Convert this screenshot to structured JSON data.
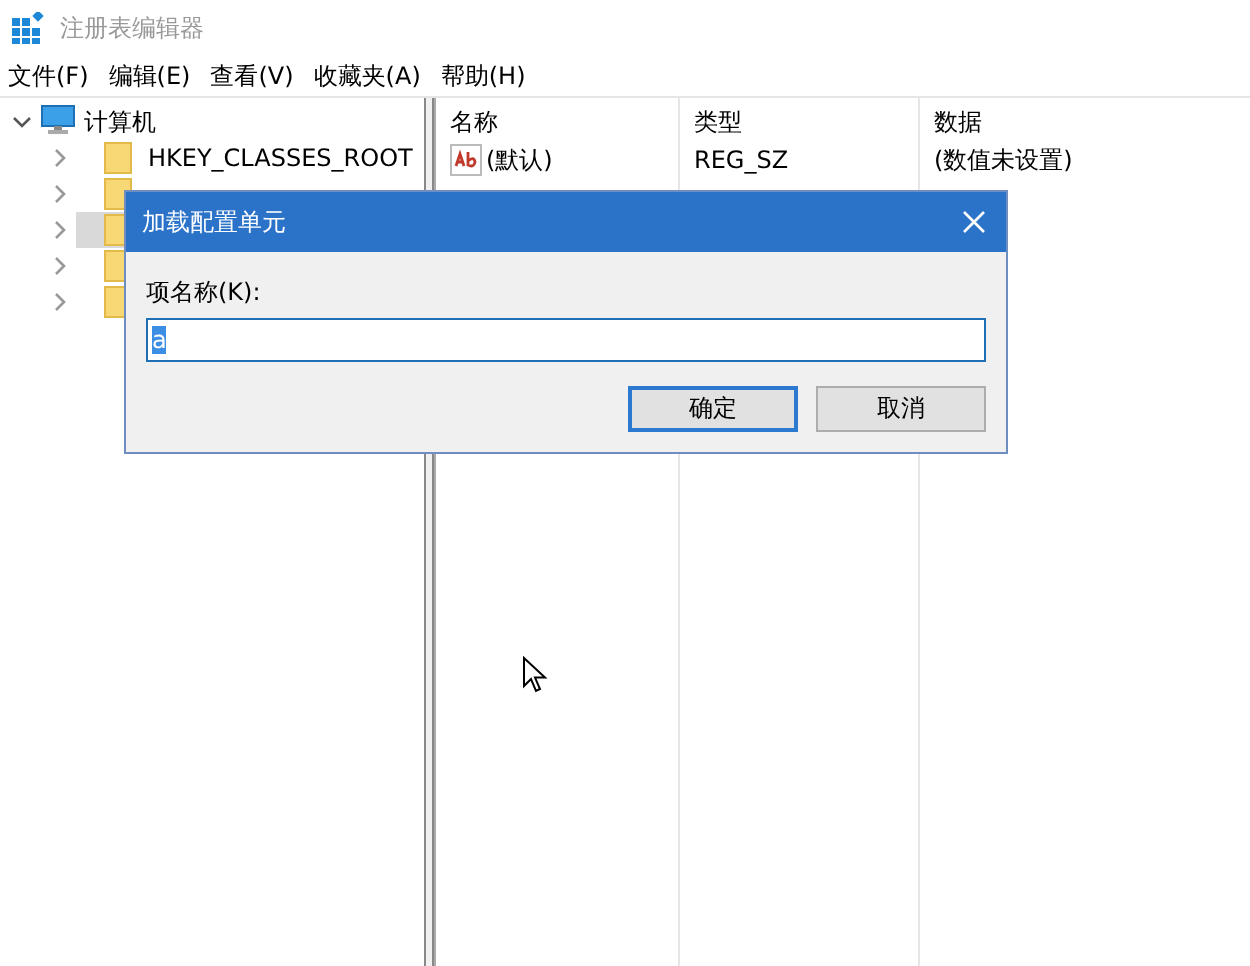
{
  "window": {
    "title": "注册表编辑器"
  },
  "menu": [
    "文件(F)",
    "编辑(E)",
    "查看(V)",
    "收藏夹(A)",
    "帮助(H)"
  ],
  "tree": {
    "label": "计算机",
    "expanded": true,
    "children": [
      {
        "label": "HKEY_CLASSES_ROOT",
        "selected": false
      },
      {
        "selected": false
      },
      {
        "selected": true
      },
      {
        "selected": false
      },
      {
        "selected": false
      }
    ]
  },
  "table": {
    "columns": [
      "名称",
      "类型",
      "数据"
    ],
    "rows": [
      {
        "name": "(默认)",
        "type": "REG_SZ",
        "data": "(数值未设置)"
      }
    ]
  },
  "dialog": {
    "title": "加载配置单元",
    "label": "项名称(K):",
    "value": "a",
    "value_selected": true,
    "buttons": [
      {
        "label": "确定",
        "default": true
      },
      {
        "label": "取消",
        "default": false
      }
    ]
  }
}
